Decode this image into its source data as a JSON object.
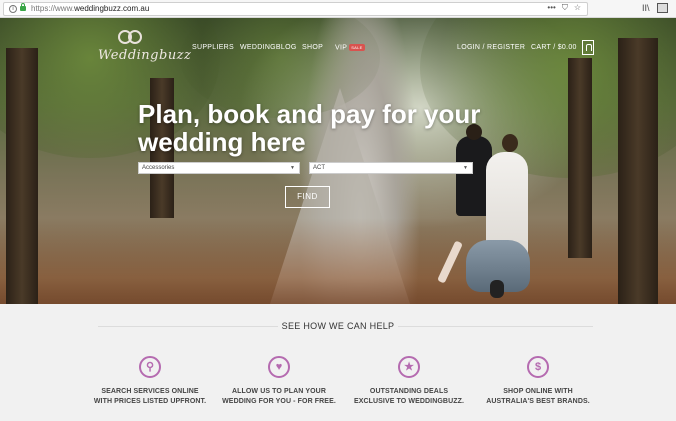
{
  "browser": {
    "url_prefix": "https://www.",
    "url_domain": "weddingbuzz.com.au",
    "actions": [
      "•••",
      "⛉",
      "☆"
    ]
  },
  "site": {
    "logo_text": "Weddingbuzz",
    "nav": {
      "suppliers": "SUPPLIERS",
      "blog": "WEDDINGBLOG",
      "shop": "SHOP",
      "vip": "VIP",
      "vip_badge": "SALE",
      "login": "LOGIN / REGISTER",
      "cart": "CART / $0.00"
    }
  },
  "hero": {
    "headline": "Plan, book and pay for your wedding here",
    "service_select": "Accessories",
    "state_select": "ACT",
    "find_label": "FIND"
  },
  "help": {
    "title": "SEE HOW WE CAN HELP",
    "features": [
      {
        "icon": "search-icon",
        "glyph": "⚲",
        "line1": "SEARCH SERVICES ONLINE",
        "line2": "WITH PRICES LISTED UPFRONT."
      },
      {
        "icon": "heart-icon",
        "glyph": "♥",
        "line1": "ALLOW US TO PLAN YOUR",
        "line2": "WEDDING FOR YOU - FOR FREE."
      },
      {
        "icon": "star-icon",
        "glyph": "★",
        "line1": "OUTSTANDING DEALS",
        "line2": "EXCLUSIVE TO WEDDINGBUZZ."
      },
      {
        "icon": "dollar-icon",
        "glyph": "$",
        "line1": "SHOP ONLINE WITH",
        "line2": "AUSTRALIA'S BEST BRANDS."
      }
    ],
    "accent_color": "#b56bb0"
  }
}
